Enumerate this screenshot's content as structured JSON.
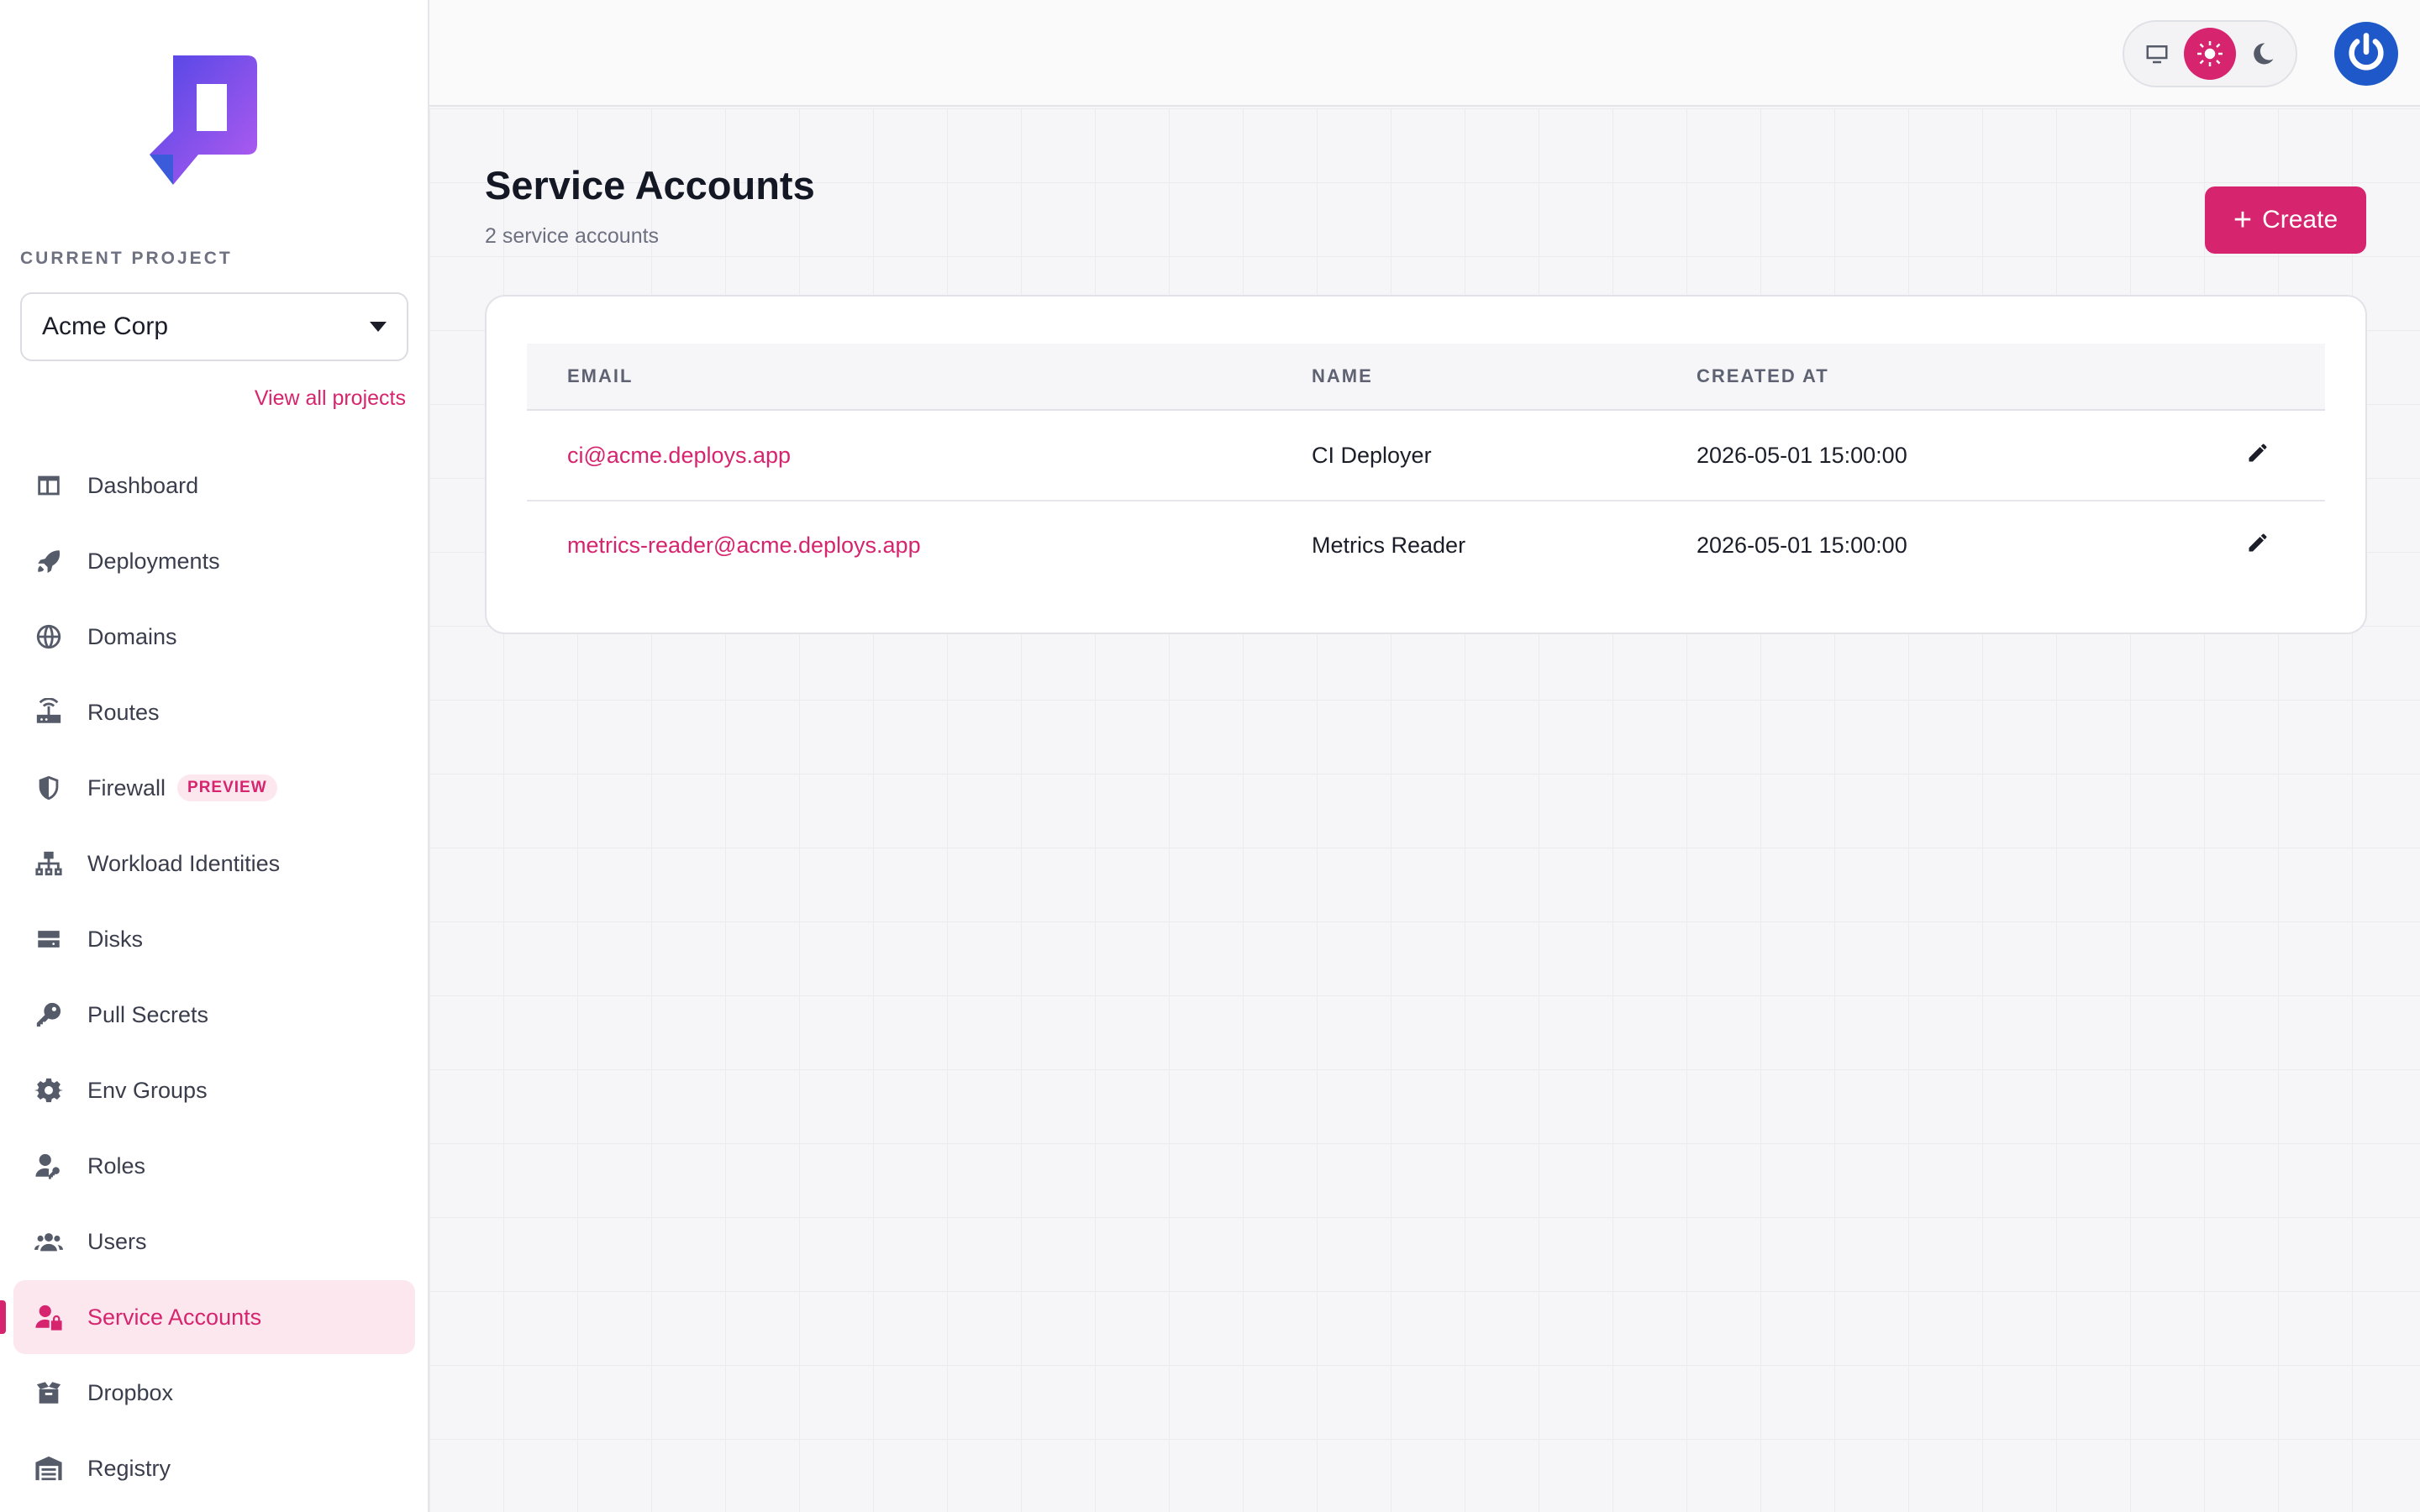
{
  "sidebar": {
    "section_label": "CURRENT PROJECT",
    "project": "Acme Corp",
    "view_all": "View all projects",
    "items": [
      {
        "label": "Dashboard",
        "icon": "dashboard-icon"
      },
      {
        "label": "Deployments",
        "icon": "rocket-icon"
      },
      {
        "label": "Domains",
        "icon": "globe-icon"
      },
      {
        "label": "Routes",
        "icon": "router-icon"
      },
      {
        "label": "Firewall",
        "icon": "shield-icon",
        "badge": "PREVIEW"
      },
      {
        "label": "Workload Identities",
        "icon": "network-icon"
      },
      {
        "label": "Disks",
        "icon": "disk-icon"
      },
      {
        "label": "Pull Secrets",
        "icon": "key-icon"
      },
      {
        "label": "Env Groups",
        "icon": "gear-icon"
      },
      {
        "label": "Roles",
        "icon": "user-key-icon"
      },
      {
        "label": "Users",
        "icon": "users-icon"
      },
      {
        "label": "Service Accounts",
        "icon": "user-lock-icon",
        "active": true
      },
      {
        "label": "Dropbox",
        "icon": "box-icon"
      },
      {
        "label": "Registry",
        "icon": "warehouse-icon"
      }
    ]
  },
  "topbar": {
    "theme_options": [
      "system",
      "light",
      "dark"
    ],
    "theme_selected": "light"
  },
  "main": {
    "title": "Service Accounts",
    "subtitle": "2 service accounts",
    "create_label": "Create",
    "table": {
      "headers": {
        "email": "EMAIL",
        "name": "NAME",
        "created_at": "CREATED AT"
      },
      "rows": [
        {
          "email": "ci@acme.deploys.app",
          "name": "CI Deployer",
          "created_at": "2026-05-01 15:00:00"
        },
        {
          "email": "metrics-reader@acme.deploys.app",
          "name": "Metrics Reader",
          "created_at": "2026-05-01 15:00:00"
        }
      ]
    }
  },
  "colors": {
    "accent": "#d6246e",
    "accent_soft": "#fde7ef",
    "avatar": "#1f59c9",
    "logo_gradient": [
      "#3b5bdb",
      "#a855f7"
    ]
  }
}
